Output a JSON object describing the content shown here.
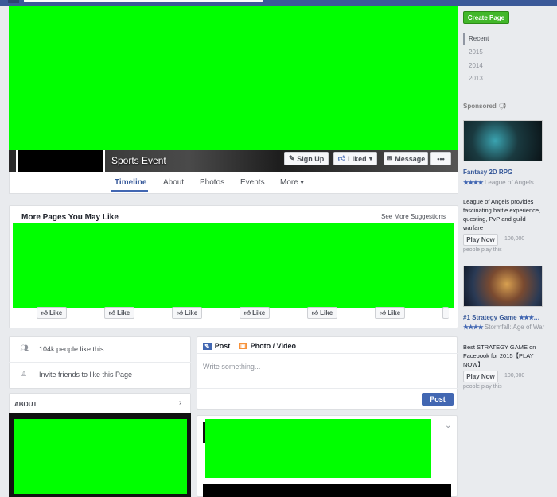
{
  "cover": {
    "category": "Sports Event",
    "buttons": {
      "sign_up": "Sign Up",
      "liked": "Liked",
      "message": "Message",
      "more": "•••"
    }
  },
  "tabs": [
    {
      "label": "Timeline",
      "active": true
    },
    {
      "label": "About"
    },
    {
      "label": "Photos"
    },
    {
      "label": "Events"
    },
    {
      "label": "More"
    }
  ],
  "suggestions": {
    "title": "More Pages You May Like",
    "see_more": "See More Suggestions",
    "like_label": "Like"
  },
  "page_info": {
    "likes": "104k people like this",
    "invite": "Invite friends to like this Page"
  },
  "about": {
    "title": "ABOUT"
  },
  "composer": {
    "tab_post": "Post",
    "tab_photo": "Photo / Video",
    "placeholder": "Write something...",
    "post_button": "Post"
  },
  "sidebar": {
    "create_page": "Create Page",
    "years": [
      "Recent",
      "2015",
      "2014",
      "2013"
    ],
    "sponsored": "Sponsored",
    "ads": [
      {
        "title": "Fantasy 2D RPG",
        "stars": "★★★★",
        "rating_text": "League of Angels",
        "description": "League of Angels provides fascinating battle experience, questing, PvP and guild warfare",
        "cta": "Play Now",
        "count": "100,000",
        "sub": "people play this"
      },
      {
        "title": "#1 Strategy Game",
        "stars": "★★★★",
        "rating_text": "Stormfall: Age of War",
        "description": "Best STRATEGY GAME on Facebook for 2015【PLAY NOW】",
        "cta": "Play Now",
        "count": "100,000",
        "sub": "people play this"
      }
    ]
  },
  "colors": {
    "brand": "#3b5998",
    "redaction": "#00ff00",
    "create_page": "#42b72a",
    "post_button": "#4267b2"
  }
}
